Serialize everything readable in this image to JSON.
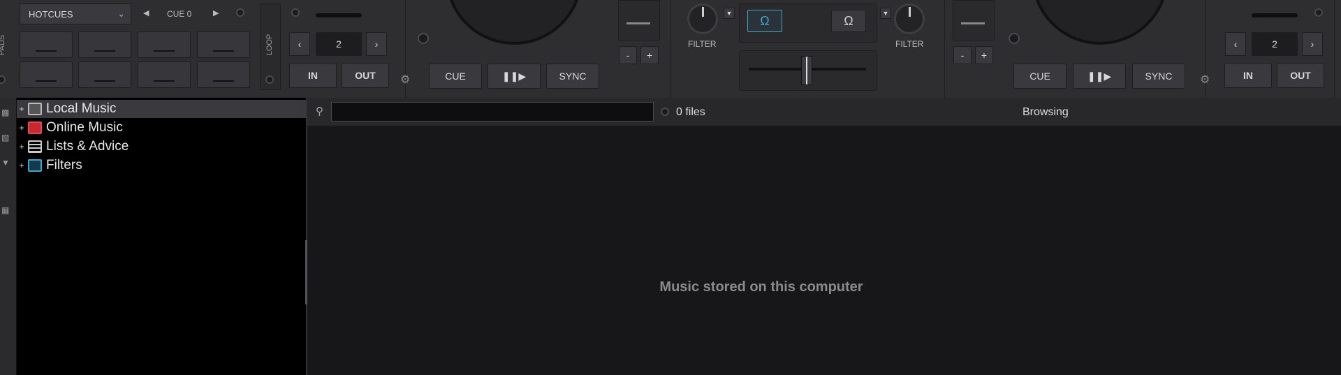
{
  "deck_left": {
    "pads_label": "PADS",
    "hotcues_select": "HOTCUES",
    "cue_label": "CUE 0",
    "loop_label": "LOOP",
    "loop_value": "2",
    "in_label": "IN",
    "out_label": "OUT",
    "cue_button": "CUE",
    "sync_button": "SYNC"
  },
  "mixer": {
    "filter_left": "FILTER",
    "filter_right": "FILTER",
    "minus": "-",
    "plus": "+"
  },
  "deck_right": {
    "loop_value": "2",
    "in_label": "IN",
    "out_label": "OUT",
    "cue_button": "CUE",
    "sync_button": "SYNC"
  },
  "tree": {
    "items": [
      {
        "label": "Local Music",
        "icon": "computer-icon",
        "selected": true
      },
      {
        "label": "Online Music",
        "icon": "globe-icon",
        "selected": false
      },
      {
        "label": "Lists & Advice",
        "icon": "list-icon",
        "selected": false
      },
      {
        "label": "Filters",
        "icon": "filter-folder-icon",
        "selected": false
      }
    ]
  },
  "browser": {
    "search_placeholder": "",
    "file_count": "0 files",
    "status": "Browsing",
    "empty_message": "Music stored on this computer",
    "folders_tab": "folders"
  },
  "colors": {
    "accent": "#3aa6c9",
    "globe": "#c8282e",
    "background": "#141416"
  }
}
